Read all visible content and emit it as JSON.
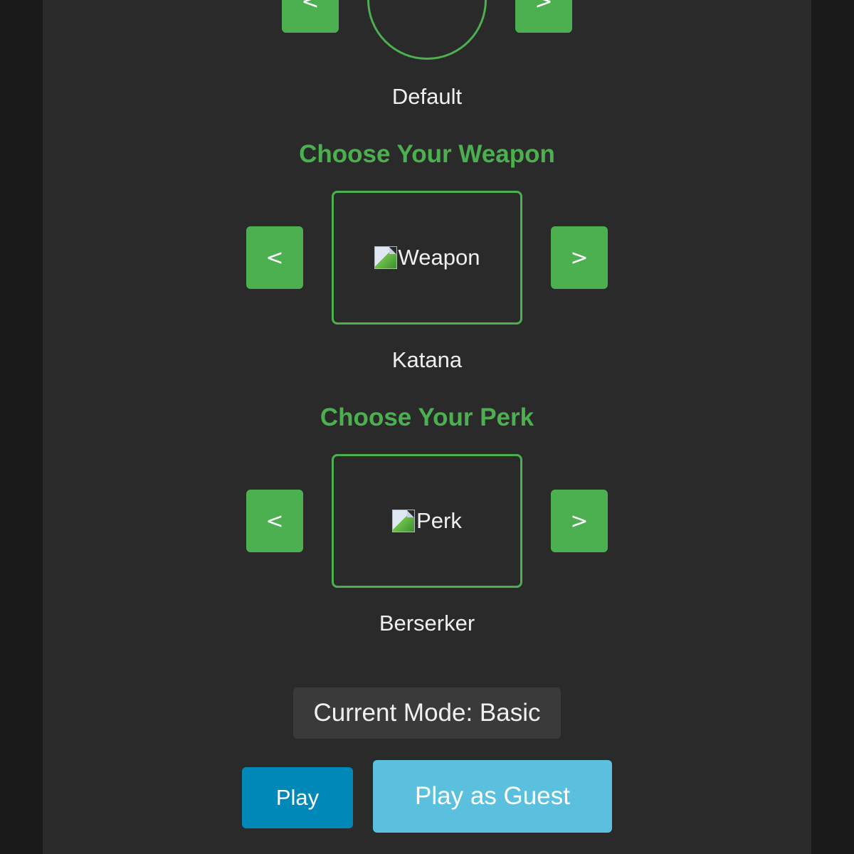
{
  "skin": {
    "prev_label": "<",
    "next_label": ">",
    "name": "Default"
  },
  "weapon": {
    "title": "Choose Your Weapon",
    "prev_label": "<",
    "next_label": ">",
    "image_alt": "Weapon",
    "name": "Katana"
  },
  "perk": {
    "title": "Choose Your Perk",
    "prev_label": "<",
    "next_label": ">",
    "image_alt": "Perk",
    "name": "Berserker"
  },
  "mode": {
    "label": "Current Mode: Basic"
  },
  "actions": {
    "play_label": "Play",
    "guest_label": "Play as Guest"
  },
  "colors": {
    "accent_green": "#4caf50",
    "play_blue": "#0089b8",
    "guest_blue": "#5bc0de",
    "panel_bg": "#2a2a2a",
    "page_bg": "#1a1a1a"
  }
}
